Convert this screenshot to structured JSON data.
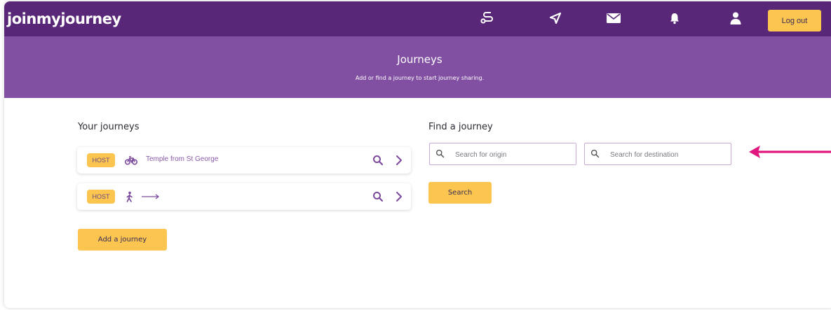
{
  "header": {
    "brand": "joinmyjourney",
    "nav_icons": [
      "route-icon",
      "send-icon",
      "mail-icon",
      "bell-icon",
      "user-icon"
    ],
    "logout_label": "Log out"
  },
  "banner": {
    "title": "Journeys",
    "subtitle": "Add or find a journey to start journey sharing."
  },
  "your_journeys": {
    "heading": "Your journeys",
    "items": [
      {
        "badge": "HOST",
        "mode": "bike-icon",
        "name": "Temple from St George"
      },
      {
        "badge": "HOST",
        "mode": "walk-icon",
        "name": ""
      }
    ],
    "add_label": "Add a journey"
  },
  "find_journey": {
    "heading": "Find a journey",
    "origin_placeholder": "Search for origin",
    "destination_placeholder": "Search for destination",
    "search_label": "Search"
  },
  "colors": {
    "header_bg": "#582777",
    "banner_bg": "#8250a2",
    "accent_yellow": "#fbc54f",
    "annotation_arrow": "#e0177e"
  }
}
